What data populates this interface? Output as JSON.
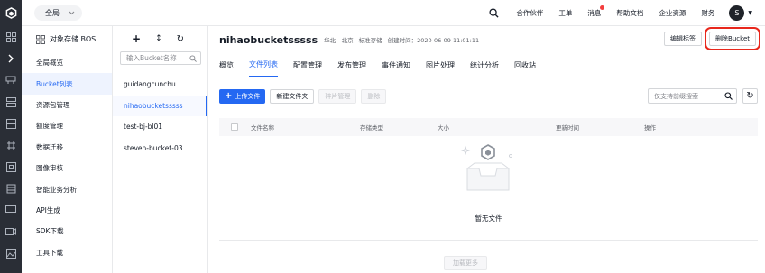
{
  "topbar": {
    "region": "全局",
    "links": [
      "合作伙伴",
      "工单",
      "消息",
      "帮助文档",
      "企业资源",
      "财务"
    ],
    "avatar": "S",
    "accent": "#2468f2"
  },
  "sidenav": {
    "title": "对象存储 BOS",
    "items": [
      "全局概览",
      "Bucket列表",
      "资源包管理",
      "额度管理",
      "数据迁移",
      "图像审核",
      "智能业务分析",
      "API生成",
      "SDK下载",
      "工具下载"
    ]
  },
  "bucket_panel": {
    "search_placeholder": "输入Bucket名称",
    "buckets": [
      "guidangcunchu",
      "nihaobucketsssss",
      "test-bj-bl01",
      "steven-bucket-03"
    ]
  },
  "header": {
    "bucket_name": "nihaobucketsssss",
    "region": "华北 - 北京",
    "storage_class": "标准存储",
    "created": "创建时间：2020-06-09 11:01:11",
    "edit_tags": "编辑标签",
    "delete_bucket": "删除Bucket"
  },
  "tabs": [
    "概览",
    "文件列表",
    "配置管理",
    "发布管理",
    "事件通知",
    "图片处理",
    "统计分析",
    "回收站"
  ],
  "toolbar": {
    "upload": "上传文件",
    "new_folder": "新建文件夹",
    "fragment": "碎片管理",
    "delete": "删除",
    "search_placeholder": "仅支持前缀搜索"
  },
  "table": {
    "columns": [
      "文件名称",
      "存储类型",
      "大小",
      "更新时间",
      "操作"
    ],
    "empty_text": "暂无文件"
  },
  "load_more": "加载更多"
}
